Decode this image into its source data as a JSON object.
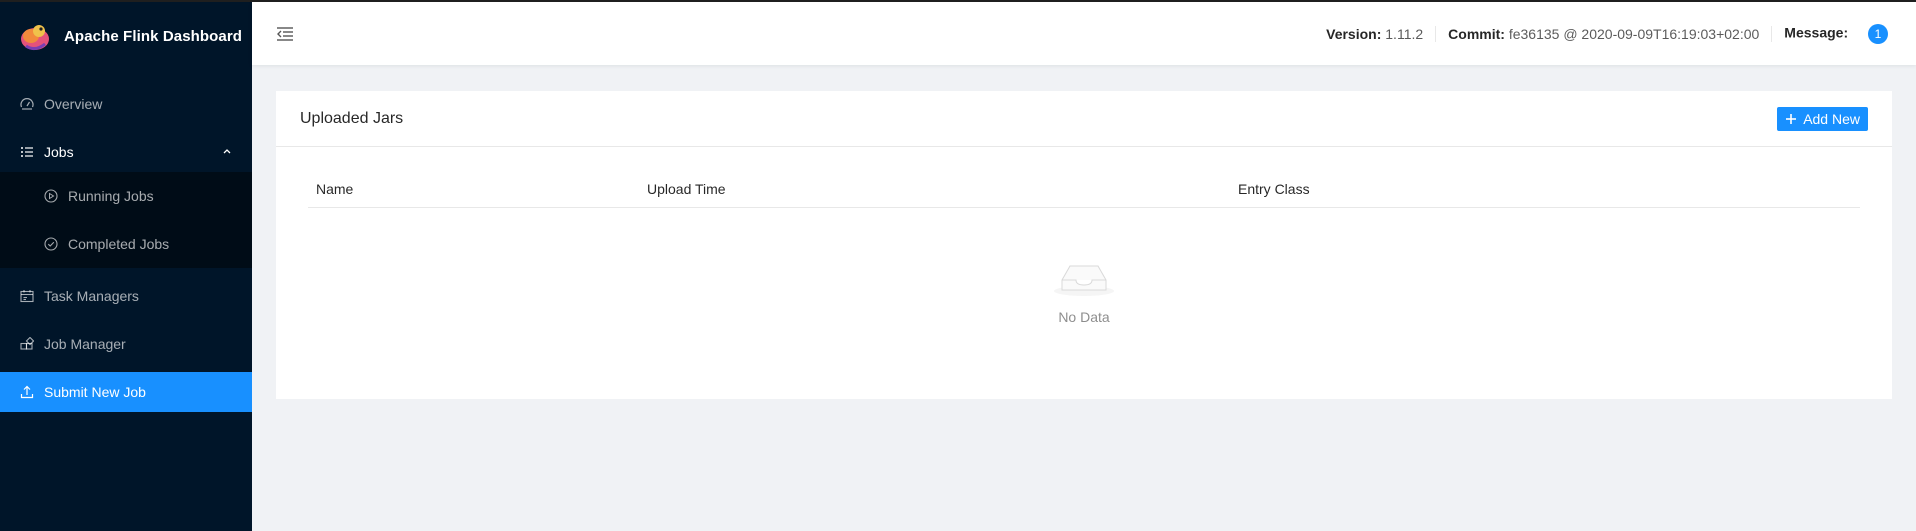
{
  "app": {
    "title": "Apache Flink Dashboard"
  },
  "sidebar": {
    "items": [
      {
        "label": "Overview",
        "icon": "dashboard-icon"
      },
      {
        "label": "Jobs",
        "icon": "unordered-list-icon"
      },
      {
        "label": "Running Jobs",
        "icon": "play-circle-icon"
      },
      {
        "label": "Completed Jobs",
        "icon": "check-circle-icon"
      },
      {
        "label": "Task Managers",
        "icon": "schedule-icon"
      },
      {
        "label": "Job Manager",
        "icon": "build-icon"
      },
      {
        "label": "Submit New Job",
        "icon": "upload-icon"
      }
    ]
  },
  "header": {
    "version_label": "Version:",
    "version_value": "1.11.2",
    "commit_label": "Commit:",
    "commit_value": "fe36135 @ 2020-09-09T16:19:03+02:00",
    "message_label": "Message:",
    "message_count": "1"
  },
  "card": {
    "title": "Uploaded Jars",
    "add_button": "Add New",
    "columns": [
      "Name",
      "Upload Time",
      "Entry Class"
    ],
    "empty_text": "No Data"
  },
  "colors": {
    "sider_bg": "#001529",
    "accent": "#1890ff"
  }
}
